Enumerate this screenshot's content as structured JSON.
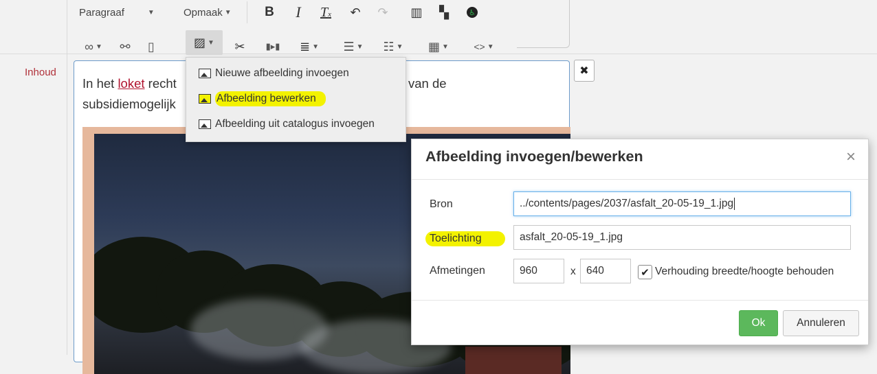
{
  "field": {
    "label": "Inhoud"
  },
  "toolbar": {
    "paragraph_label": "Paragraaf",
    "format_label": "Opmaak"
  },
  "editor": {
    "line1_before": "In het ",
    "link_text": "loket",
    "line1_after": " recht",
    "line2": "subsidiemogelijk",
    "tail_text": "van de",
    "close_symbol": "✖"
  },
  "image_menu": {
    "items": [
      {
        "label": "Nieuwe afbeelding invoegen",
        "icon": "image-icon"
      },
      {
        "label": "Afbeelding bewerken",
        "icon": "image-edit-icon",
        "highlighted": true
      },
      {
        "label": "Afbeelding uit catalogus invoegen",
        "icon": "image-catalog-icon"
      }
    ]
  },
  "dialog": {
    "title": "Afbeelding invoegen/bewerken",
    "close_symbol": "×",
    "source_label": "Bron",
    "source_value": "../contents/pages/2037/asfalt_20-05-19_1.jpg",
    "caption_label": "Toelichting",
    "caption_value": "asfalt_20-05-19_1.jpg",
    "dimensions_label": "Afmetingen",
    "width_value": "960",
    "times_symbol": "x",
    "height_value": "640",
    "keep_ratio_label": "Verhouding breedte/hoogte behouden",
    "keep_ratio_checked": true,
    "ok_label": "Ok",
    "cancel_label": "Annuleren"
  },
  "colors": {
    "accent_label": "#b0313a",
    "highlight": "#f3f200",
    "ok_button": "#5cb85c",
    "focus_border": "#66afe9"
  }
}
